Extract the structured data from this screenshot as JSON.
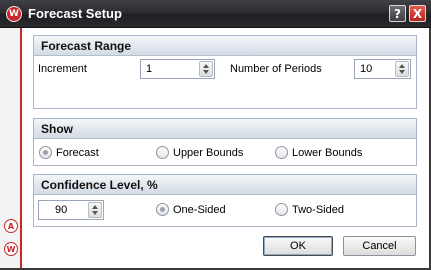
{
  "window": {
    "title": "Forecast Setup",
    "logo_letter": "W",
    "help_glyph": "?",
    "close_glyph": "X"
  },
  "sidebar": {
    "icons": [
      {
        "letter": "A",
        "name": "a-badge-icon"
      },
      {
        "letter": "W",
        "name": "w-logo-icon"
      }
    ]
  },
  "forecast_range": {
    "header": "Forecast Range",
    "increment_label": "Increment",
    "increment_value": "1",
    "periods_label": "Number of Periods",
    "periods_value": "10"
  },
  "show": {
    "header": "Show",
    "options": [
      "Forecast",
      "Upper Bounds",
      "Lower Bounds"
    ],
    "selected": "Forecast"
  },
  "confidence": {
    "header": "Confidence Level, %",
    "value": "90",
    "options": [
      "One-Sided",
      "Two-Sided"
    ],
    "selected": "One-Sided"
  },
  "buttons": {
    "ok": "OK",
    "cancel": "Cancel"
  },
  "colors": {
    "accent": "#c8282a",
    "title_bar": "#2c2c31",
    "group_border": "#a9b7c9"
  }
}
